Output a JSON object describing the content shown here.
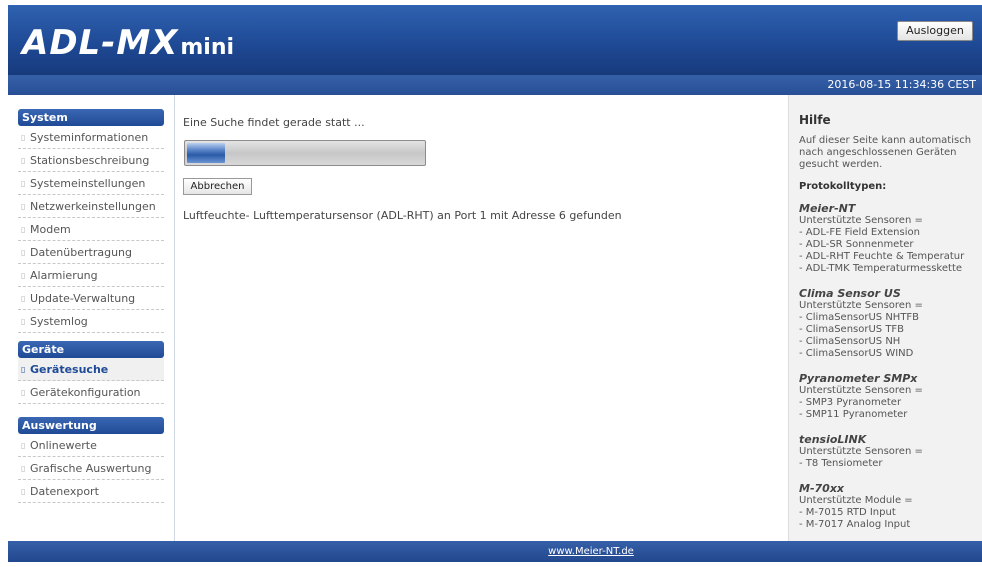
{
  "header": {
    "logo_main": "ADL-MX",
    "logo_mini": "mini",
    "logout_label": "Ausloggen",
    "timestamp": "2016-08-15 11:34:36 CEST"
  },
  "sidebar": {
    "sections": [
      {
        "title": "System",
        "items": [
          {
            "label": "Systeminformationen",
            "active": false
          },
          {
            "label": "Stationsbeschreibung",
            "active": false
          },
          {
            "label": "Systemeinstellungen",
            "active": false
          },
          {
            "label": "Netzwerkeinstellungen",
            "active": false
          },
          {
            "label": "Modem",
            "active": false
          },
          {
            "label": "Datenübertragung",
            "active": false
          },
          {
            "label": "Alarmierung",
            "active": false
          },
          {
            "label": "Update-Verwaltung",
            "active": false
          },
          {
            "label": "Systemlog",
            "active": false
          }
        ]
      },
      {
        "title": "Geräte",
        "items": [
          {
            "label": "Gerätesuche",
            "active": true
          },
          {
            "label": "Gerätekonfiguration",
            "active": false
          }
        ]
      },
      {
        "title": "Auswertung",
        "items": [
          {
            "label": "Onlinewerte",
            "active": false
          },
          {
            "label": "Grafische Auswertung",
            "active": false
          },
          {
            "label": "Datenexport",
            "active": false
          }
        ]
      }
    ]
  },
  "main": {
    "search_status": "Eine Suche findet gerade statt ...",
    "progress_fraction": 0.16,
    "cancel_label": "Abbrechen",
    "found_message": "Luftfeuchte- Lufttemperatursensor (ADL-RHT) an Port 1 mit Adresse 6 gefunden"
  },
  "help": {
    "title": "Hilfe",
    "intro": "Auf dieser Seite kann automatisch nach angeschlossenen Geräten gesucht werden.",
    "protocol_label": "Protokolltypen:",
    "protocols": [
      {
        "name": "Meier-NT",
        "lines": [
          "Unterstützte Sensoren =",
          "- ADL-FE Field Extension",
          "- ADL-SR Sonnenmeter",
          "- ADL-RHT Feuchte & Temperatur",
          "- ADL-TMK Temperaturmesskette"
        ]
      },
      {
        "name": "Clima Sensor US",
        "lines": [
          "Unterstützte Sensoren =",
          "- ClimaSensorUS NHTFB",
          "- ClimaSensorUS TFB",
          "- ClimaSensorUS NH",
          "- ClimaSensorUS WIND"
        ]
      },
      {
        "name": "Pyranometer SMPx",
        "lines": [
          "Unterstützte Sensoren =",
          "- SMP3 Pyranometer",
          "- SMP11 Pyranometer"
        ]
      },
      {
        "name": "tensioLINK",
        "lines": [
          "Unterstützte Sensoren =",
          "- T8 Tensiometer"
        ]
      },
      {
        "name": "M-70xx",
        "lines": [
          "Unterstützte Module =",
          "- M-7015 RTD Input",
          "- M-7017 Analog Input"
        ]
      }
    ]
  },
  "footer": {
    "link": "www.Meier-NT.de"
  },
  "colors": {
    "brand_blue": "#1f4a96",
    "help_bg": "#f2f2f2"
  }
}
